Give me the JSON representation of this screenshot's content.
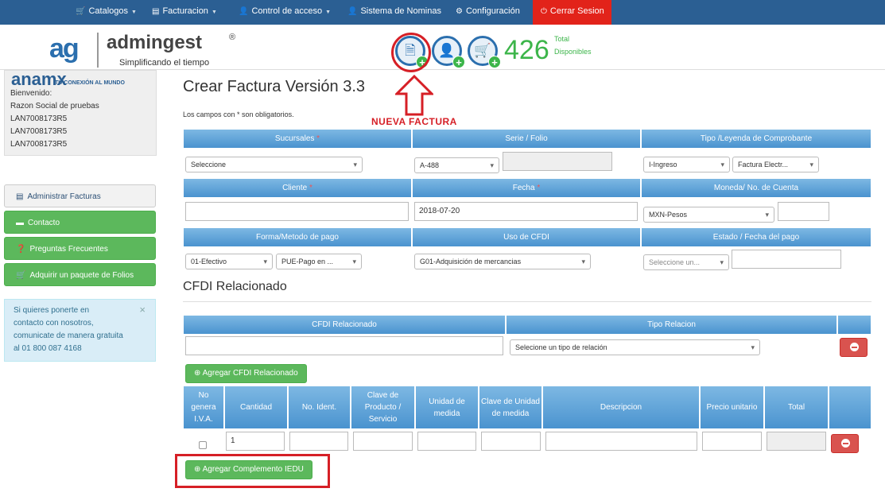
{
  "nav": {
    "catalogos": "Catalogos",
    "facturacion": "Facturacion",
    "control_acceso": "Control de acceso",
    "nominas": "Sistema de Nominas",
    "configuracion": "Configuración",
    "cerrar": "Cerrar Sesion"
  },
  "header": {
    "logo_ag": "ag",
    "logo_name": "admingest",
    "logo_reg": "®",
    "logo_tag": "Simplificando el tiempo",
    "count": "426",
    "count_label_1": "Total",
    "count_label_2": "Disponibles"
  },
  "sidebar": {
    "brand": "anamx",
    "slogan": "TU CONEXIÓN AL MUNDO",
    "welcome": "Bienvenido:",
    "razon": "Razon Social de pruebas",
    "rfc1": "LAN7008173R5",
    "rfc2": "LAN7008173R5",
    "rfc3": "LAN7008173R5",
    "administrar": "Administrar Facturas",
    "contacto": "Contacto",
    "preguntas": "Preguntas Frecuentes",
    "adquirir": "Adquirir un paquete de Folios",
    "info_1": "Si quieres ponerte en",
    "info_2": "contacto con nosotros,",
    "info_3": "comunicate de manera gratuita",
    "info_4": "al 01 800 087 4168"
  },
  "main": {
    "title": "Crear Factura Versión 3.3",
    "req_note": "Los campos con * son obligatorios.",
    "nueva_factura": "NUEVA FACTURA",
    "h_sucursales": "Sucursales",
    "h_serie": "Serie / Folio",
    "h_tipo": "Tipo /Leyenda de Comprobante",
    "sel_sucursal": "Seleccione",
    "sel_serie": "A-488",
    "sel_tipo": "I-Ingreso",
    "sel_leyenda": "Factura Electr...",
    "h_cliente": "Cliente",
    "h_fecha": "Fecha",
    "h_moneda": "Moneda/ No. de Cuenta",
    "fecha_val": "2018-07-20",
    "sel_moneda": "MXN-Pesos",
    "h_forma": "Forma/Metodo de pago",
    "h_uso": "Uso de CFDI",
    "h_estado": "Estado / Fecha del pago",
    "sel_forma": "01-Efectivo",
    "sel_metodo": "PUE-Pago en ...",
    "sel_uso": "G01-Adquisición de mercancias",
    "sel_estado": "Seleccione un...",
    "required_mark": "*"
  },
  "cfdi": {
    "section": "CFDI Relacionado",
    "h_rel": "CFDI Relacionado",
    "h_tipo_rel": "Tipo Relacion",
    "sel_tipo_rel": "Selecione un tipo de relación",
    "agregar": "Agregar CFDI Relacionado"
  },
  "items": {
    "h_no_iva": "No genera I.V.A.",
    "h_cantidad": "Cantidad",
    "h_ident": "No. Ident.",
    "h_clave_prod": "Clave de Producto / Servicio",
    "h_unidad": "Unidad de medida",
    "h_clave_unidad": "Clave de Unidad de medida",
    "h_desc": "Descripcion",
    "h_precio": "Precio unitario",
    "h_total": "Total",
    "cantidad_val": "1",
    "agregar_iedu": "Agregar Complemento IEDU"
  }
}
